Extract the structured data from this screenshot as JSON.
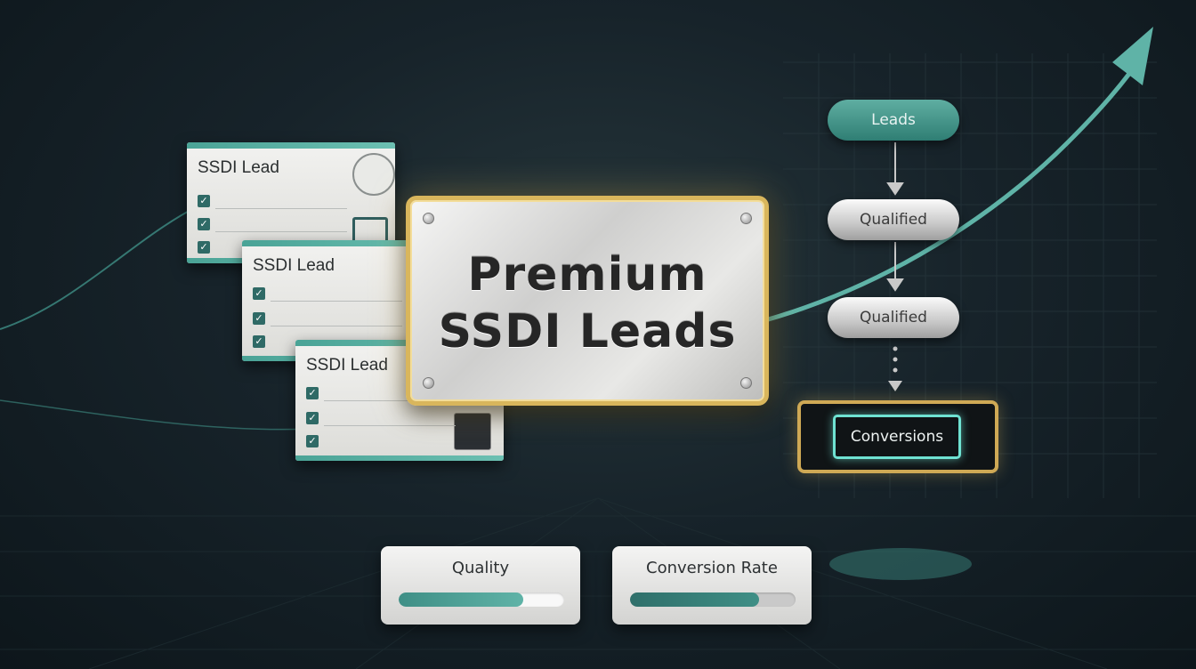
{
  "hero": {
    "line1": "Premium",
    "line2": "SSDI Leads"
  },
  "lead_cards": [
    {
      "title": "SSDI Lead"
    },
    {
      "title": "SSDI Lead"
    },
    {
      "title": "SSDI Lead"
    }
  ],
  "funnel": {
    "stages": [
      "Leads",
      "Qualified",
      "Qualified"
    ],
    "final": "Conversions"
  },
  "metrics": [
    {
      "label": "Quality",
      "level": 0.75
    },
    {
      "label": "Conversion Rate",
      "level": 0.78
    }
  ],
  "colors": {
    "accent": "#5fb3a7",
    "gold": "#d9b65c",
    "background": "#17232a"
  }
}
